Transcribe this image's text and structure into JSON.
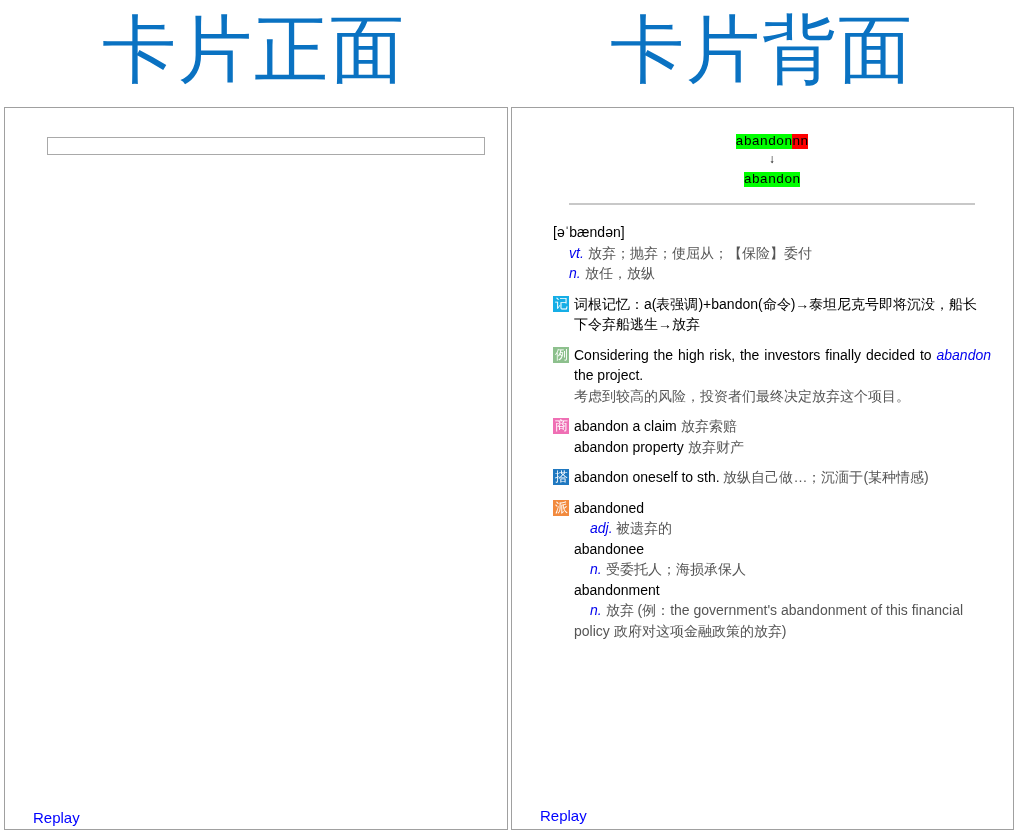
{
  "headings": [
    "卡片正面",
    "卡片背面"
  ],
  "front": {
    "replay": "Replay"
  },
  "back": {
    "comparison": {
      "typed": [
        {
          "text": "abandon",
          "correct": true
        },
        {
          "text": "nn",
          "correct": false
        }
      ],
      "arrow": "↓",
      "answer": "abandon"
    },
    "phonetic": "[əˈbændən]",
    "senses": [
      {
        "pos": "vt.",
        "meaning": "放弃；抛弃；使屈从；【保险】委付"
      },
      {
        "pos": "n.",
        "meaning": "放任，放纵"
      }
    ],
    "sections": [
      {
        "kind": "memory",
        "badge": "记",
        "color": "#16aee6",
        "text": "词根记忆：a(表强调)+bandon(命令)→泰坦尼克号即将沉没，船长下令弃船逃生→放弃"
      },
      {
        "kind": "example",
        "badge": "例",
        "color": "#8dc08d",
        "sentence": "Considering the high risk, the investors finally decided to *abandon* the project.",
        "translation": "考虑到较高的风险，投资者们最终决定放弃这个项目。"
      },
      {
        "kind": "phrases",
        "badge": "商",
        "color": "#ef6fb4",
        "lines": [
          {
            "phrase": "abandon a claim",
            "meaning": "放弃索赔"
          },
          {
            "phrase": "abandon property",
            "meaning": "放弃财产"
          }
        ]
      },
      {
        "kind": "phrases",
        "badge": "搭",
        "color": "#1f78c0",
        "lines": [
          {
            "phrase": "abandon oneself to sth.",
            "meaning": "放纵自己做…；沉湎于(某种情感)"
          }
        ]
      },
      {
        "kind": "derivatives",
        "badge": "派",
        "color": "#f28a3e",
        "words": [
          {
            "word": "abandoned",
            "pos": "adj.",
            "meaning": "被遗弃的"
          },
          {
            "word": "abandonee",
            "pos": "n.",
            "meaning": "受委托人；海损承保人"
          },
          {
            "word": "abandonment",
            "pos": "n.",
            "meaning": "放弃 (例：the government's abandonment of this financial policy 政府对这项金融政策的放弃)"
          }
        ]
      }
    ],
    "replay": "Replay"
  }
}
